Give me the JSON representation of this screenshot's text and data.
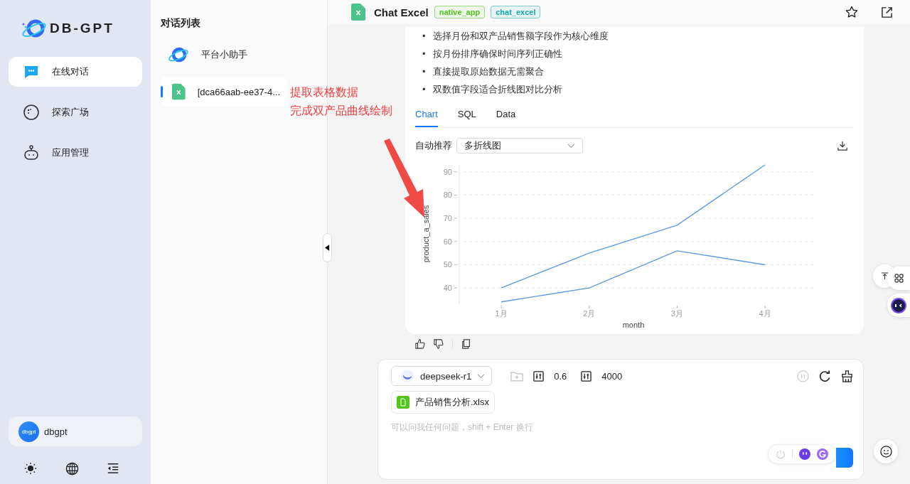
{
  "sidebar": {
    "logo_text": "DB-GPT",
    "nav_items": [
      {
        "label": "在线对话",
        "selected": true,
        "kind": "chat"
      },
      {
        "label": "探索广场",
        "selected": false,
        "kind": "explore"
      },
      {
        "label": "应用管理",
        "selected": false,
        "kind": "apps"
      }
    ],
    "user": {
      "avatar_text": "dbgpt",
      "name": "dbgpt"
    }
  },
  "conversations": {
    "title": "对话列表",
    "items": [
      {
        "title": "平台小助手",
        "selected": false,
        "kind": "assistant"
      },
      {
        "title": "[dca66aab-ee37-4...",
        "selected": true,
        "kind": "excel"
      }
    ]
  },
  "annotation": {
    "lines": [
      "提取表格数据",
      "完成双产品曲线绘制"
    ]
  },
  "header": {
    "title": "Chat Excel",
    "tags": [
      {
        "label": "native_app",
        "color": "#52c41a"
      },
      {
        "label": "chat_excel",
        "color": "#13a8a8"
      }
    ]
  },
  "message": {
    "bullets": [
      {
        "marker": "•",
        "text": "选择月份和双产品销售额字段作为核心维度"
      },
      {
        "marker": "•",
        "text": "按月份排序确保时间序列正确性"
      },
      {
        "marker": "•",
        "text": "直接提取原始数据无需聚合"
      },
      {
        "marker": "•",
        "text": "双数值字段适合折线图对比分析"
      }
    ],
    "tabs": [
      {
        "label": "Chart",
        "selected": true
      },
      {
        "label": "SQL",
        "selected": false
      },
      {
        "label": "Data",
        "selected": false
      }
    ],
    "chart_label": "自动推荐",
    "chart_type": "多折线图",
    "chart_data": {
      "type": "line",
      "xlabel": "month",
      "ylabel": "product_a_sales",
      "categories": [
        "1月",
        "2月",
        "3月",
        "4月"
      ],
      "series": [
        {
          "color": "#5b9be0",
          "values": [
            40,
            55,
            67,
            93
          ]
        },
        {
          "color": "#5b9be0",
          "values": [
            34,
            40,
            56,
            50
          ]
        }
      ],
      "yticks": [
        40,
        50,
        60,
        70,
        80,
        90
      ],
      "ylim": [
        33,
        93
      ],
      "grid": true
    }
  },
  "input": {
    "model": "deepseek-r1",
    "temperature": "0.6",
    "max_tokens": "4000",
    "attachment": "产品销售分析.xlsx",
    "placeholder": "可以问我任何问题，shift + Enter 换行"
  }
}
